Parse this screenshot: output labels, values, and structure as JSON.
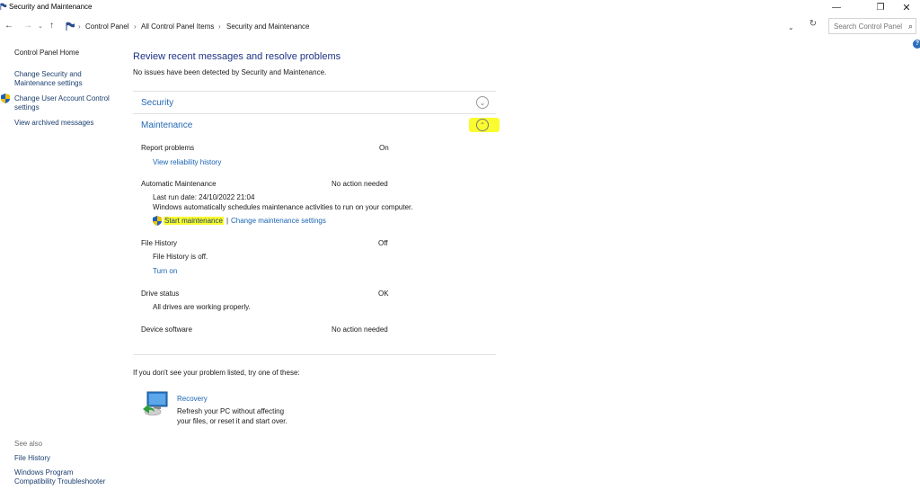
{
  "window": {
    "title": "Security and Maintenance",
    "minimize": "—",
    "maximize": "❐",
    "close": "✕"
  },
  "address": {
    "back": "←",
    "forward": "→",
    "recent": "⌄",
    "up": "↑",
    "crumbs": [
      "Control Panel",
      "All Control Panel Items",
      "Security and Maintenance"
    ],
    "separator": "›",
    "dropdown": "⌄",
    "refresh": "↻"
  },
  "search": {
    "placeholder": "Search Control Panel",
    "icon": "⌕"
  },
  "help": {
    "label": "?"
  },
  "leftnav": {
    "home": "Control Panel Home",
    "change_security_line1": "Change Security and",
    "change_security_line2": "Maintenance settings",
    "uac_line1": "Change User Account Control",
    "uac_line2": "settings",
    "archived": "View archived messages",
    "see_also": "See also",
    "file_history": "File History",
    "compat_line1": "Windows Program",
    "compat_line2": "Compatibility Troubleshooter"
  },
  "main": {
    "title": "Review recent messages and resolve problems",
    "subtitle": "No issues have been detected by Security and Maintenance.",
    "security": {
      "heading": "Security",
      "chevron": "⌄"
    },
    "maintenance": {
      "heading": "Maintenance",
      "chevron": "⌃"
    },
    "report_problems": {
      "label": "Report problems",
      "status": "On",
      "link": "View reliability history"
    },
    "auto_maintenance": {
      "label": "Automatic Maintenance",
      "status": "No action needed",
      "last_run": "Last run date: 24/10/2022 21:04",
      "description": "Windows automatically schedules maintenance activities to run on your computer.",
      "start_link": "Start maintenance",
      "pipe": "|",
      "change_link": "Change maintenance settings"
    },
    "file_history": {
      "label": "File History",
      "status": "Off",
      "detail": "File History is off.",
      "link": "Turn on"
    },
    "drive_status": {
      "label": "Drive status",
      "status": "OK",
      "detail": "All drives are working properly."
    },
    "device_software": {
      "label": "Device software",
      "status": "No action needed"
    },
    "footer": "If you don't see your problem listed, try one of these:",
    "recovery": {
      "link": "Recovery",
      "desc_line1": "Refresh your PC without affecting",
      "desc_line2": "your files, or reset it and start over."
    }
  },
  "colors": {
    "link": "#1a64b4",
    "title": "#1e3287",
    "highlight": "#fbfc2f"
  },
  "icons": {
    "app": "flag-icon",
    "shield": "shield-icon",
    "recovery": "recovery-icon"
  }
}
